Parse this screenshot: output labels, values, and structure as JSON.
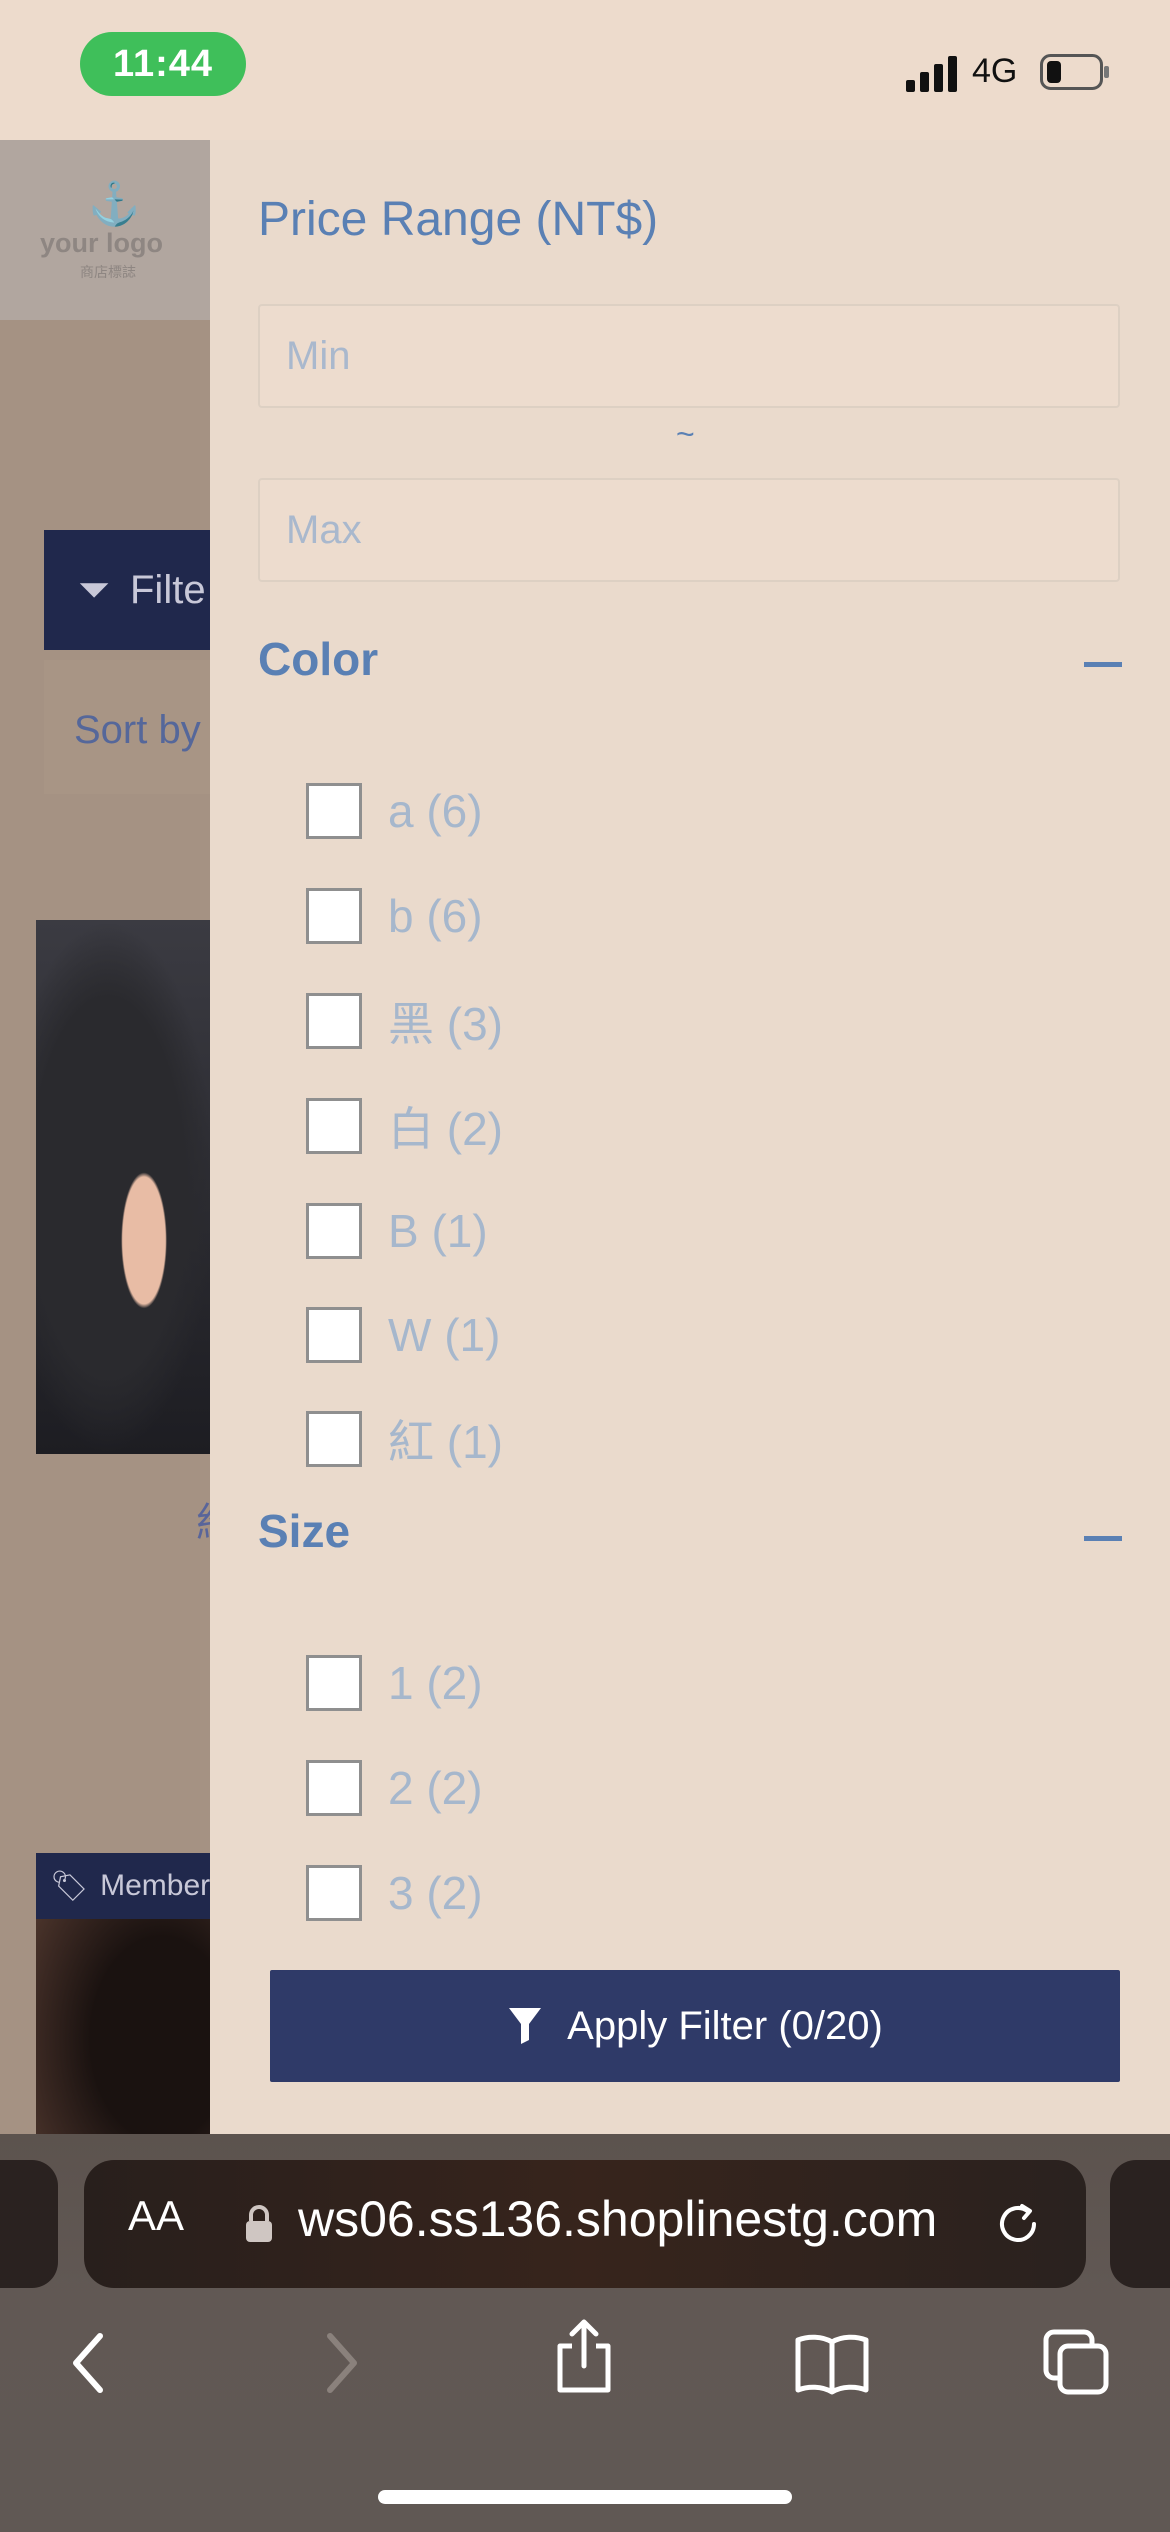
{
  "status_bar": {
    "time": "11:44",
    "network": "4G"
  },
  "background_page": {
    "logo_text": "your logo",
    "logo_subtext": "商店標誌",
    "filter_button_label": "Filte",
    "sort_label": "Sort by",
    "caption_fragment": "約",
    "member_tag": "Member"
  },
  "filter": {
    "price": {
      "title": "Price Range (NT$)",
      "min_placeholder": "Min",
      "separator": "~",
      "max_placeholder": "Max"
    },
    "color": {
      "title": "Color",
      "collapse_symbol": "—",
      "options": [
        {
          "label": "a (6)",
          "checked": false
        },
        {
          "label": "b (6)",
          "checked": false
        },
        {
          "label": "黑 (3)",
          "checked": false
        },
        {
          "label": "白 (2)",
          "checked": false
        },
        {
          "label": "B (1)",
          "checked": false
        },
        {
          "label": "W (1)",
          "checked": false
        },
        {
          "label": "紅 (1)",
          "checked": false
        }
      ]
    },
    "size": {
      "title": "Size",
      "options": [
        {
          "label": "1 (2)",
          "checked": false
        },
        {
          "label": "2 (2)",
          "checked": false
        },
        {
          "label": "3 (2)",
          "checked": false
        }
      ]
    },
    "apply_label": "Apply Filter (0/20)"
  },
  "browser": {
    "text_size_label": "AA",
    "url": "ws06.ss136.shoplinestg.com"
  },
  "colors": {
    "drawer_bg": "#eadacc",
    "accent_blue": "#5a80b4",
    "apply_button": "#2f3a68",
    "time_pill": "#3fbf5a"
  }
}
